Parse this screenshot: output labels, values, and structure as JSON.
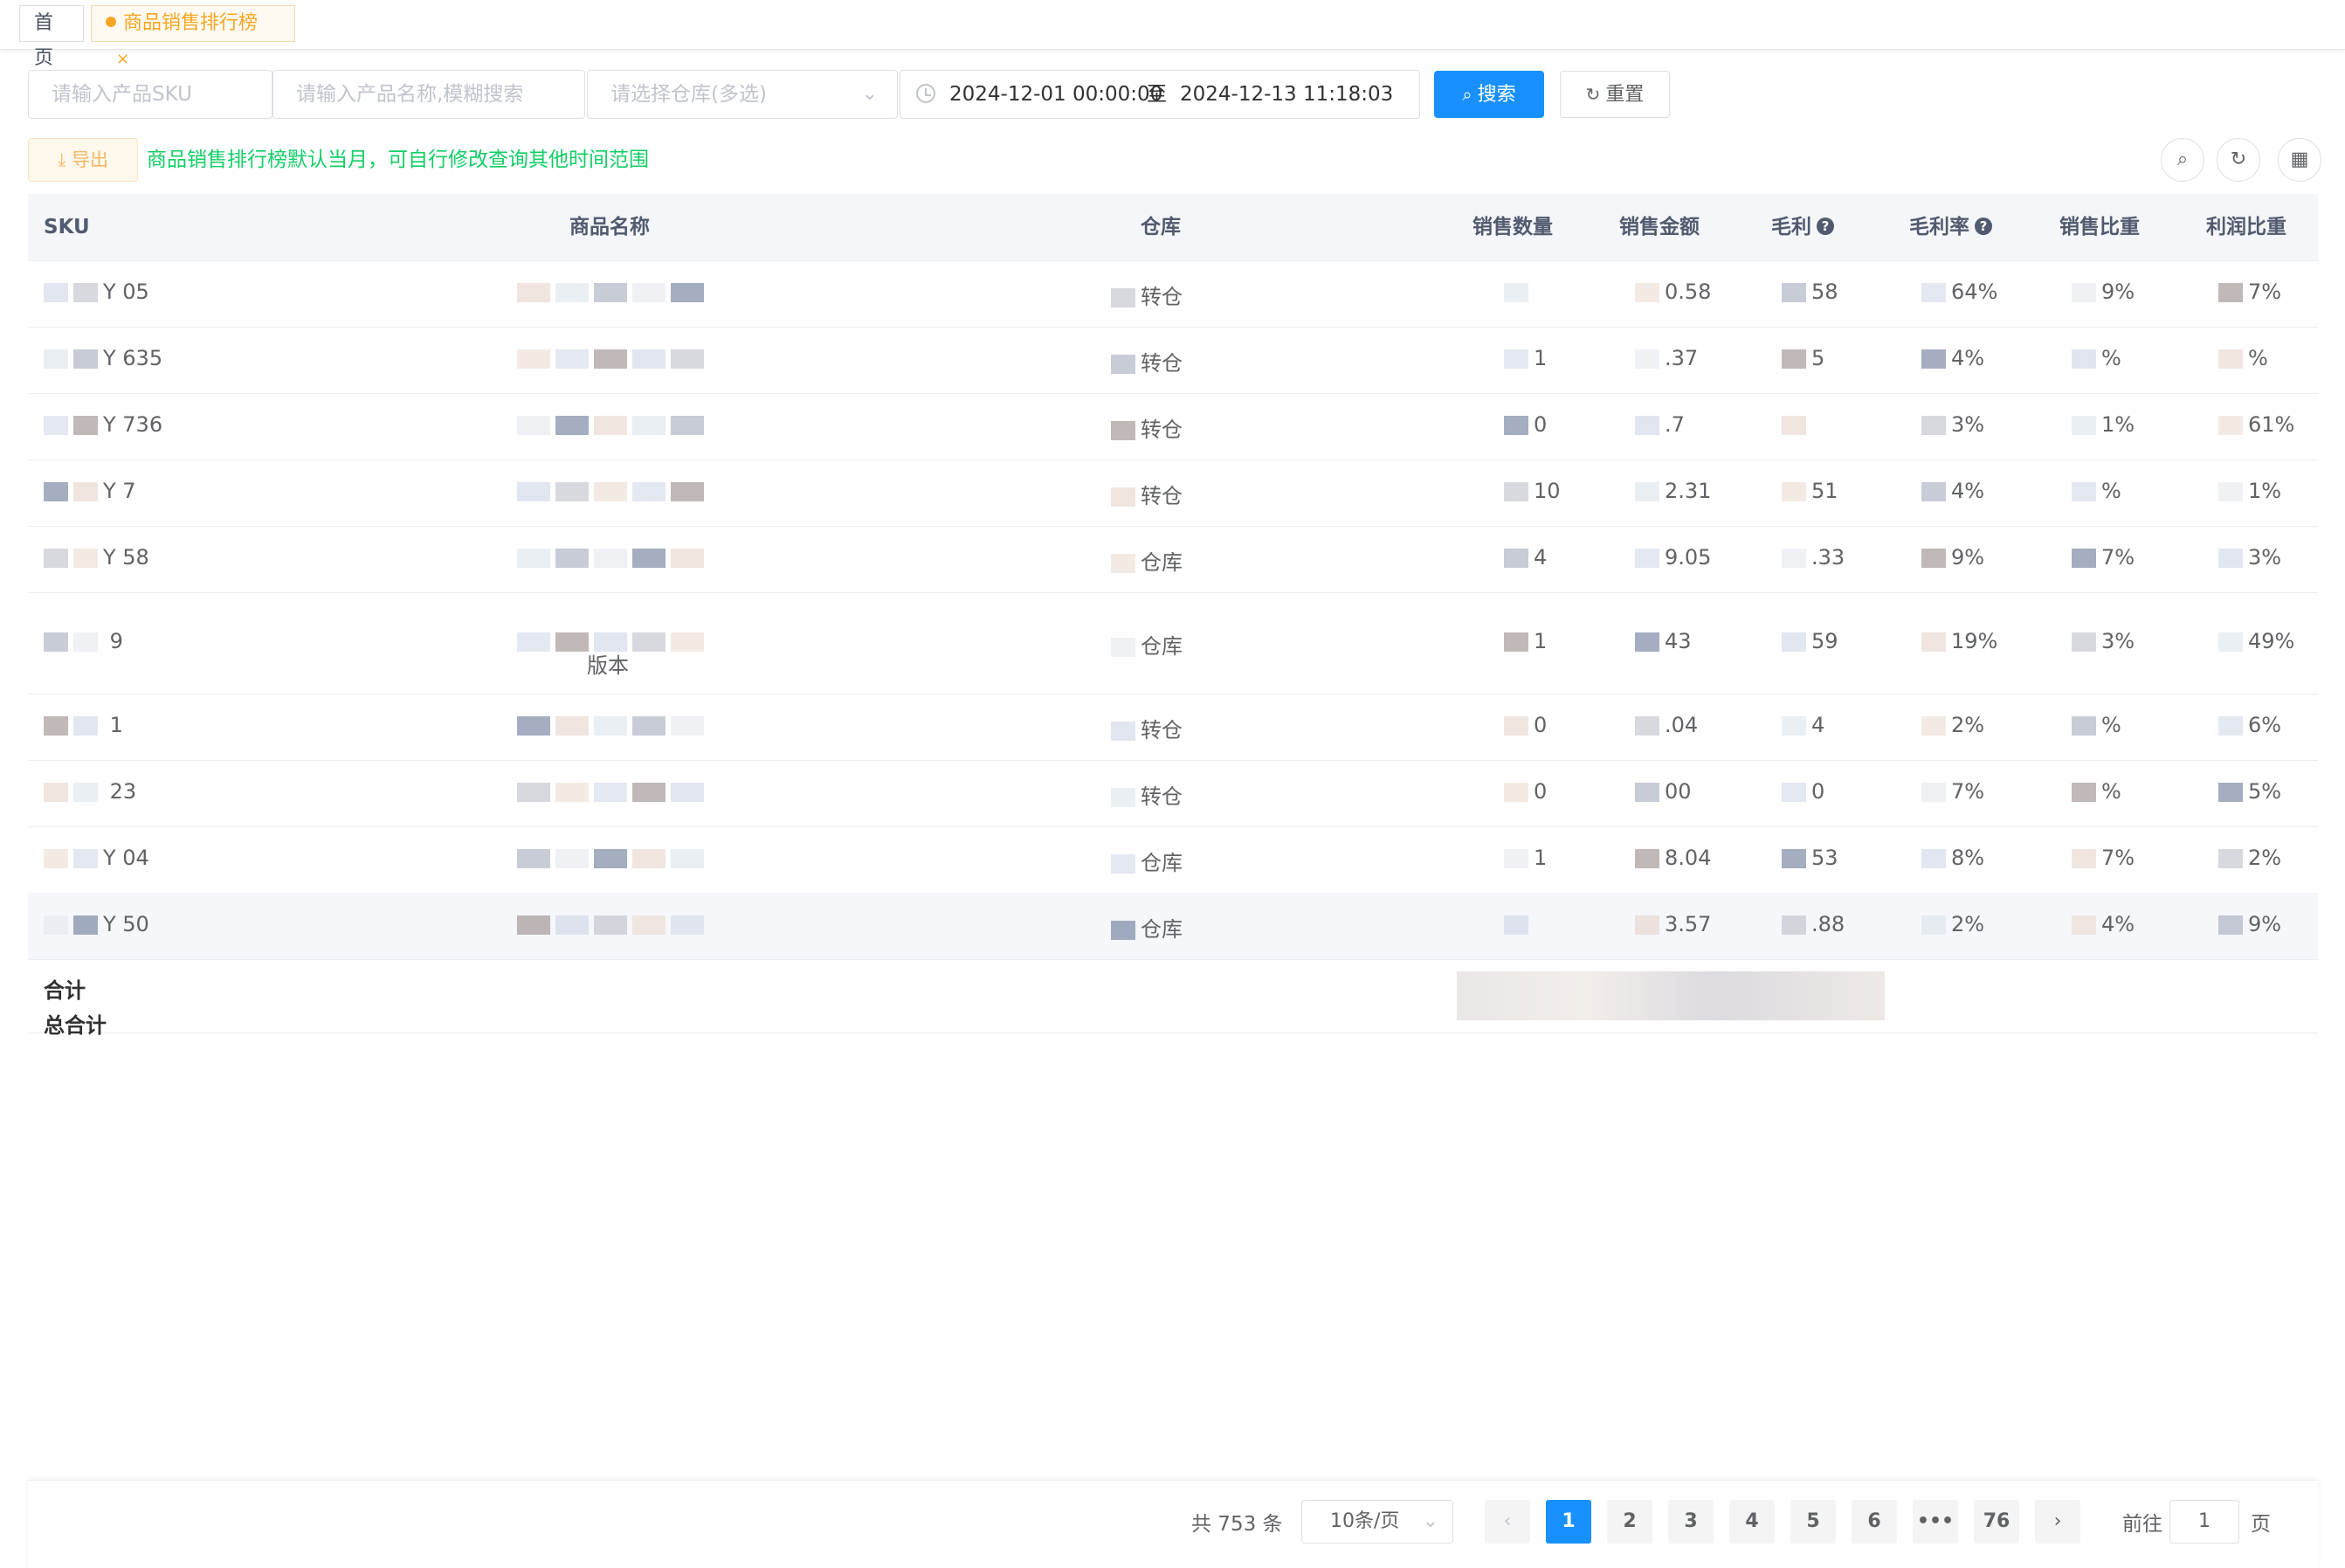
{
  "tabs": {
    "home": "首页",
    "active": "商品销售排行榜",
    "close": "×"
  },
  "filters": {
    "sku_placeholder": "请输入产品SKU",
    "name_placeholder": "请输入产品名称,模糊搜索",
    "warehouse_placeholder": "请选择仓库(多选)",
    "date_start": "2024-12-01 00:00:00",
    "date_sep": "至",
    "date_end": "2024-12-13 11:18:03",
    "search_label": "搜索",
    "reset_label": "重置"
  },
  "toolbar": {
    "export_label": "导出",
    "hint": "商品销售排行榜默认当月，可自行修改查询其他时间范围"
  },
  "table": {
    "headers": [
      "SKU",
      "商品名称",
      "仓库",
      "销售数量",
      "销售金额",
      "毛利",
      "毛利率",
      "销售比重",
      "利润比重"
    ],
    "rows": [
      {
        "sku": "Y        05",
        "name": "",
        "name2": "",
        "wh": "转仓",
        "qty": "",
        "amount": "0.58",
        "profit": "58",
        "rate": "64%",
        "sales_share": "9%",
        "profit_share": "7%"
      },
      {
        "sku": "Y        635",
        "name": "",
        "name2": "",
        "wh": "转仓",
        "qty": "1",
        "amount": ".37",
        "profit": "5",
        "rate": "4%",
        "sales_share": "%",
        "profit_share": "%"
      },
      {
        "sku": "Y        736",
        "name": "",
        "name2": "",
        "wh": "转仓",
        "qty": "0",
        "amount": ".7",
        "profit": "",
        "rate": "3%",
        "sales_share": "1%",
        "profit_share": "61%"
      },
      {
        "sku": "Y        7",
        "name": "",
        "name2": "",
        "wh": "转仓",
        "qty": "10",
        "amount": "2.31",
        "profit": "51",
        "rate": "4%",
        "sales_share": "%",
        "profit_share": "1%"
      },
      {
        "sku": "Y        58",
        "name": "",
        "name2": "",
        "wh": "仓库",
        "qty": "4",
        "amount": "9.05",
        "profit": ".33",
        "rate": "9%",
        "sales_share": "7%",
        "profit_share": "3%"
      },
      {
        "sku": "        9",
        "name": "",
        "name2": "版本",
        "wh": "仓库",
        "qty": "1",
        "amount": "43",
        "profit": "59",
        "rate": "19%",
        "sales_share": "3%",
        "profit_share": "49%"
      },
      {
        "sku": "        1",
        "name": "",
        "name2": "",
        "wh": "转仓",
        "qty": "0",
        "amount": ".04",
        "profit": "4",
        "rate": "2%",
        "sales_share": "%",
        "profit_share": "6%"
      },
      {
        "sku": "        23",
        "name": "",
        "name2": "",
        "wh": "转仓",
        "qty": "0",
        "amount": "00",
        "profit": "0",
        "rate": "7%",
        "sales_share": "%",
        "profit_share": "5%"
      },
      {
        "sku": "Y        04",
        "name": "",
        "name2": "",
        "wh": "仓库",
        "qty": "1",
        "amount": "8.04",
        "profit": "53",
        "rate": "8%",
        "sales_share": "7%",
        "profit_share": "2%"
      },
      {
        "sku": "Y        50",
        "name": "",
        "name2": "",
        "wh": "仓库",
        "qty": "",
        "amount": "3.57",
        "profit": ".88",
        "rate": "2%",
        "sales_share": "4%",
        "profit_share": "9%"
      }
    ],
    "summary": {
      "subtotal_label": "合计",
      "total_label": "总合计"
    }
  },
  "pagination": {
    "total": "共 753 条",
    "page_size": "10条/页",
    "prev": "‹",
    "pages": [
      "1",
      "2",
      "3",
      "4",
      "5",
      "6",
      "•••",
      "76"
    ],
    "next": "›",
    "goto_label": "前往",
    "goto_value": "1",
    "goto_suffix": "页"
  },
  "colors": {
    "primary": "#1890ff",
    "warning": "#f5a623",
    "success": "#13ce66",
    "header_bg": "#f4f6f9"
  }
}
